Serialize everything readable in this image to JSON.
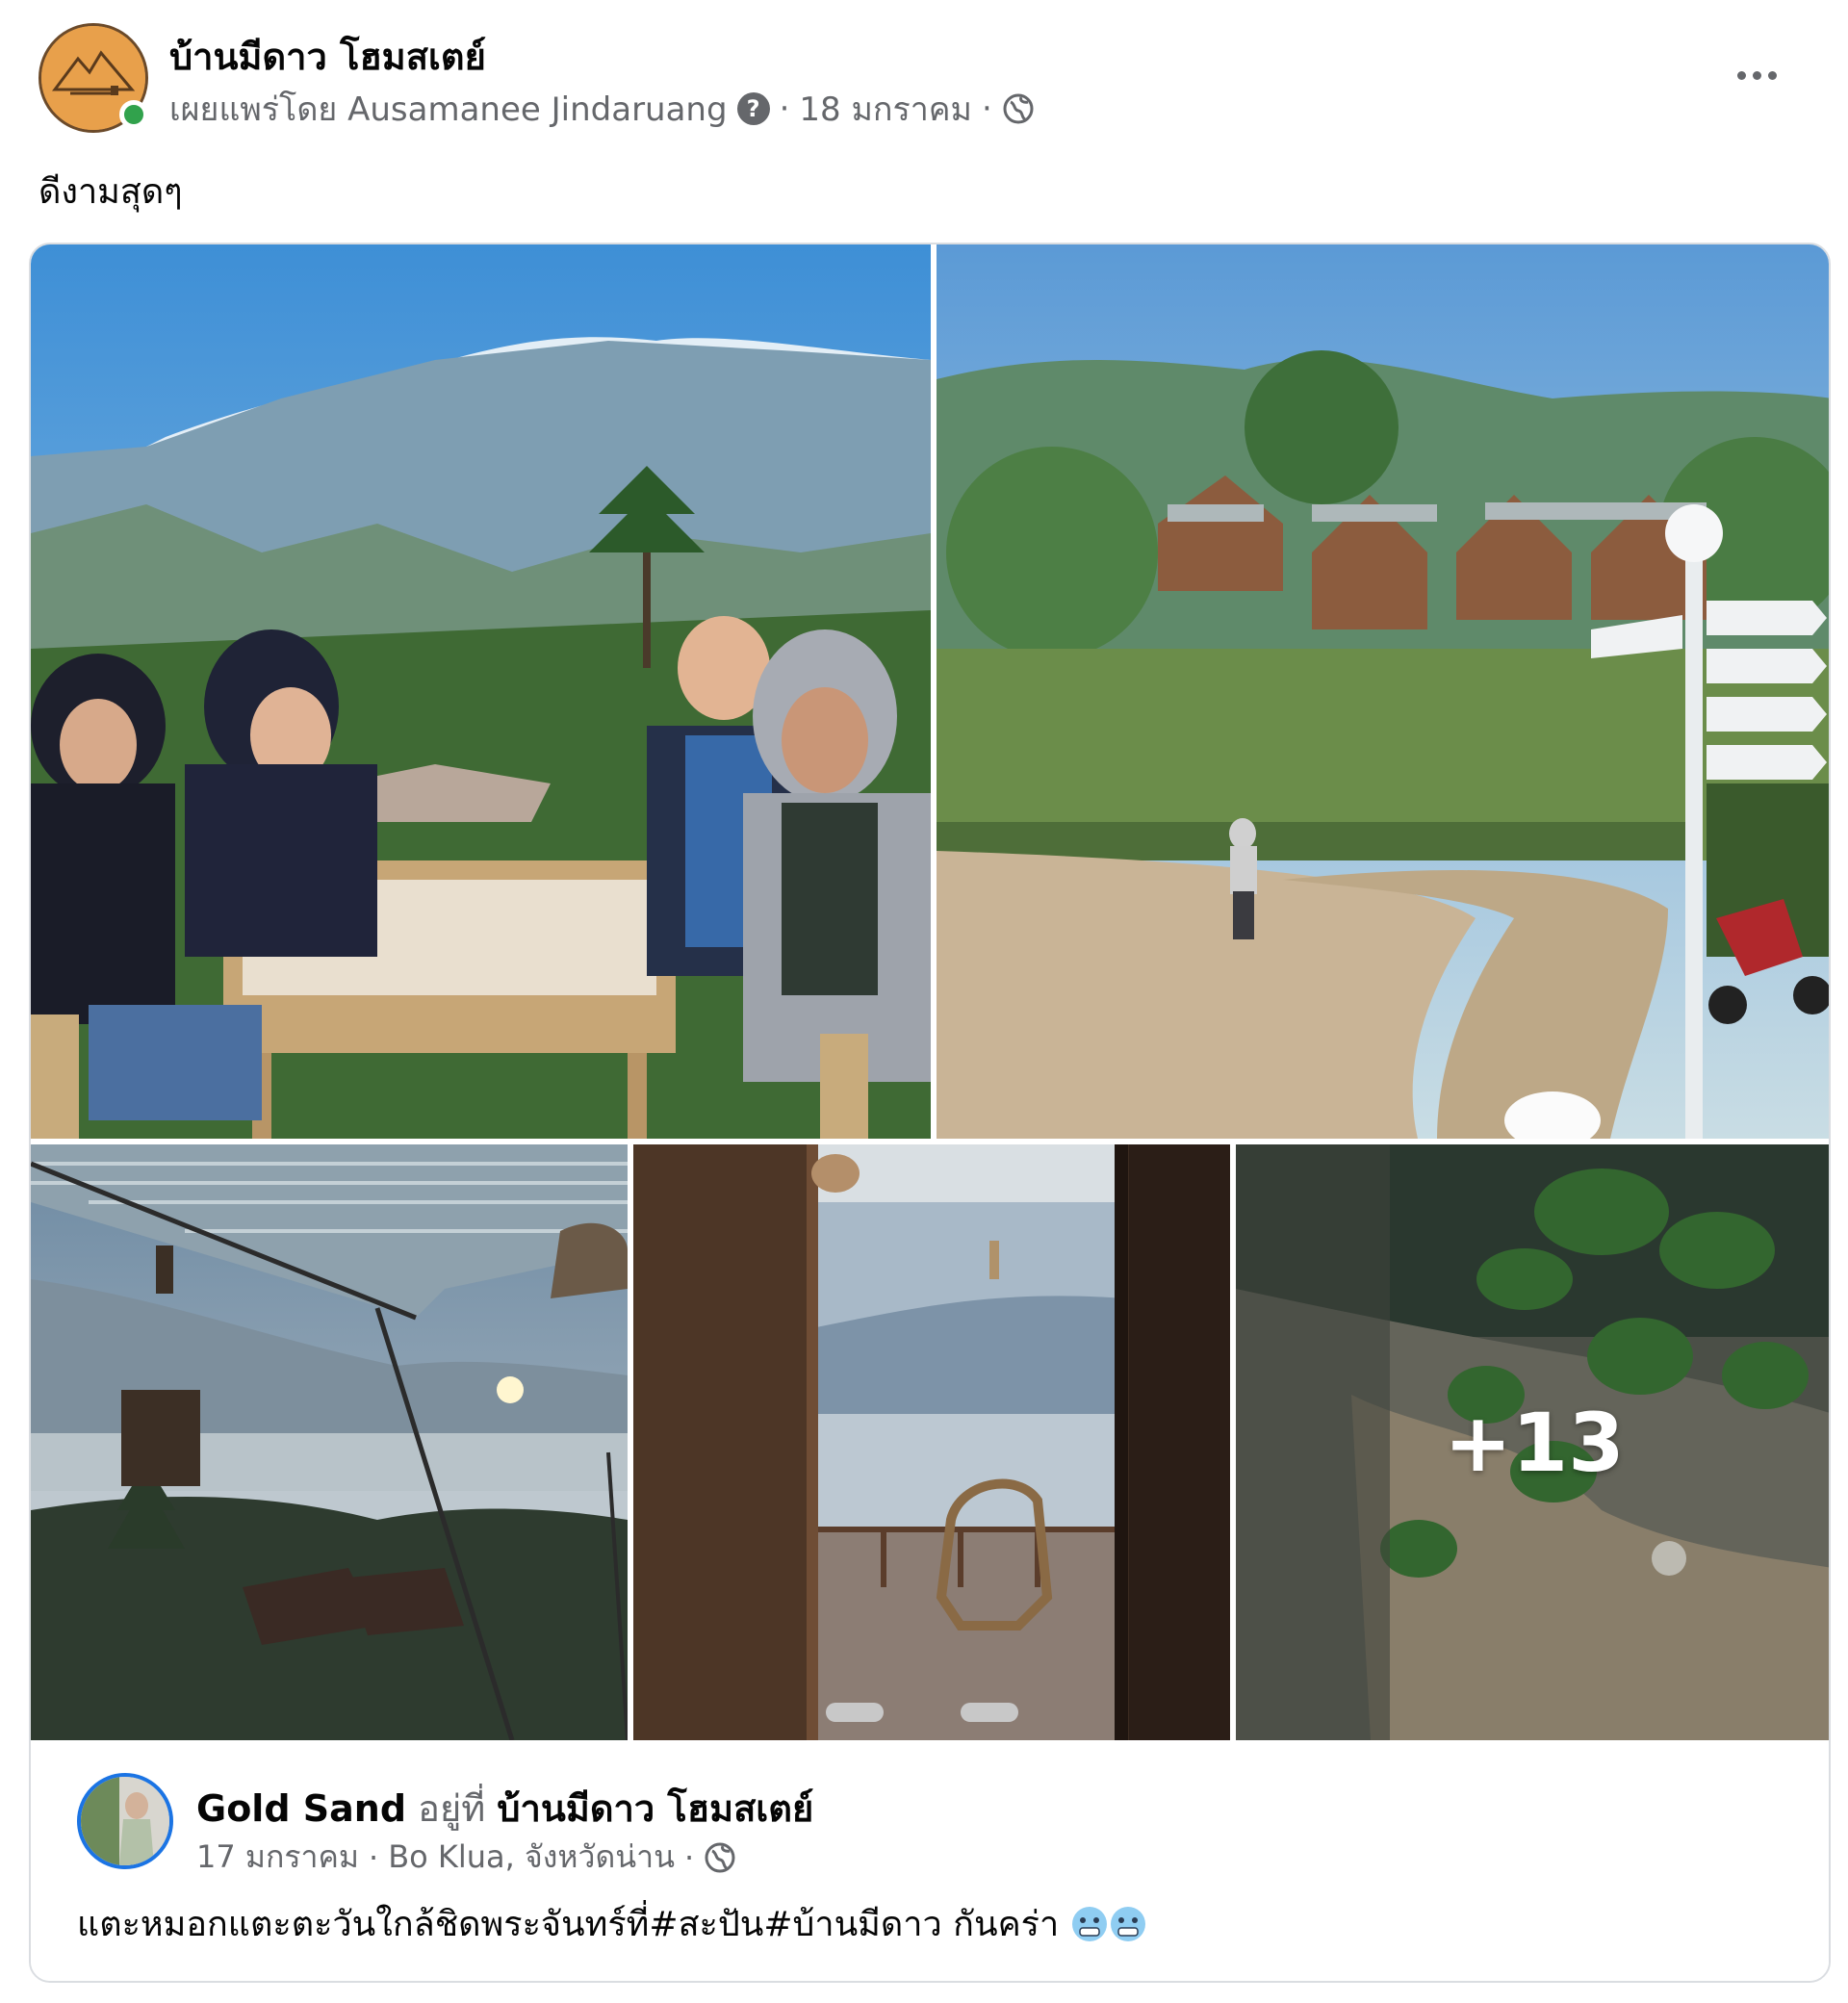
{
  "post": {
    "page_name": "บ้านมีดาว โฮมสเตย์",
    "published_by": "เผยแพร่โดย Ausamanee Jindaruang",
    "help_glyph": "?",
    "sep1": "·",
    "date": "18 มกราคม",
    "sep2": "·",
    "text": "ดีงามสุดๆ"
  },
  "photos": {
    "more_count": "+13"
  },
  "shared": {
    "author": "Gold Sand",
    "at_label": "อยู่ที่",
    "place": "บ้านมีดาว โฮมสเตย์",
    "date": "17 มกราคม",
    "sep1": "·",
    "location": "Bo Klua, จังหวัดน่าน",
    "sep2": "·",
    "text": "แตะหมอกแตะตะวันใกล้ชิดพระจันทร์ที่#สะปัน#บ้านมีดาว กันคร่า"
  },
  "icons": {
    "more": "more-horizontal-icon",
    "globe": "globe-icon",
    "help": "question-icon",
    "emoji": "cold-face-emoji"
  }
}
